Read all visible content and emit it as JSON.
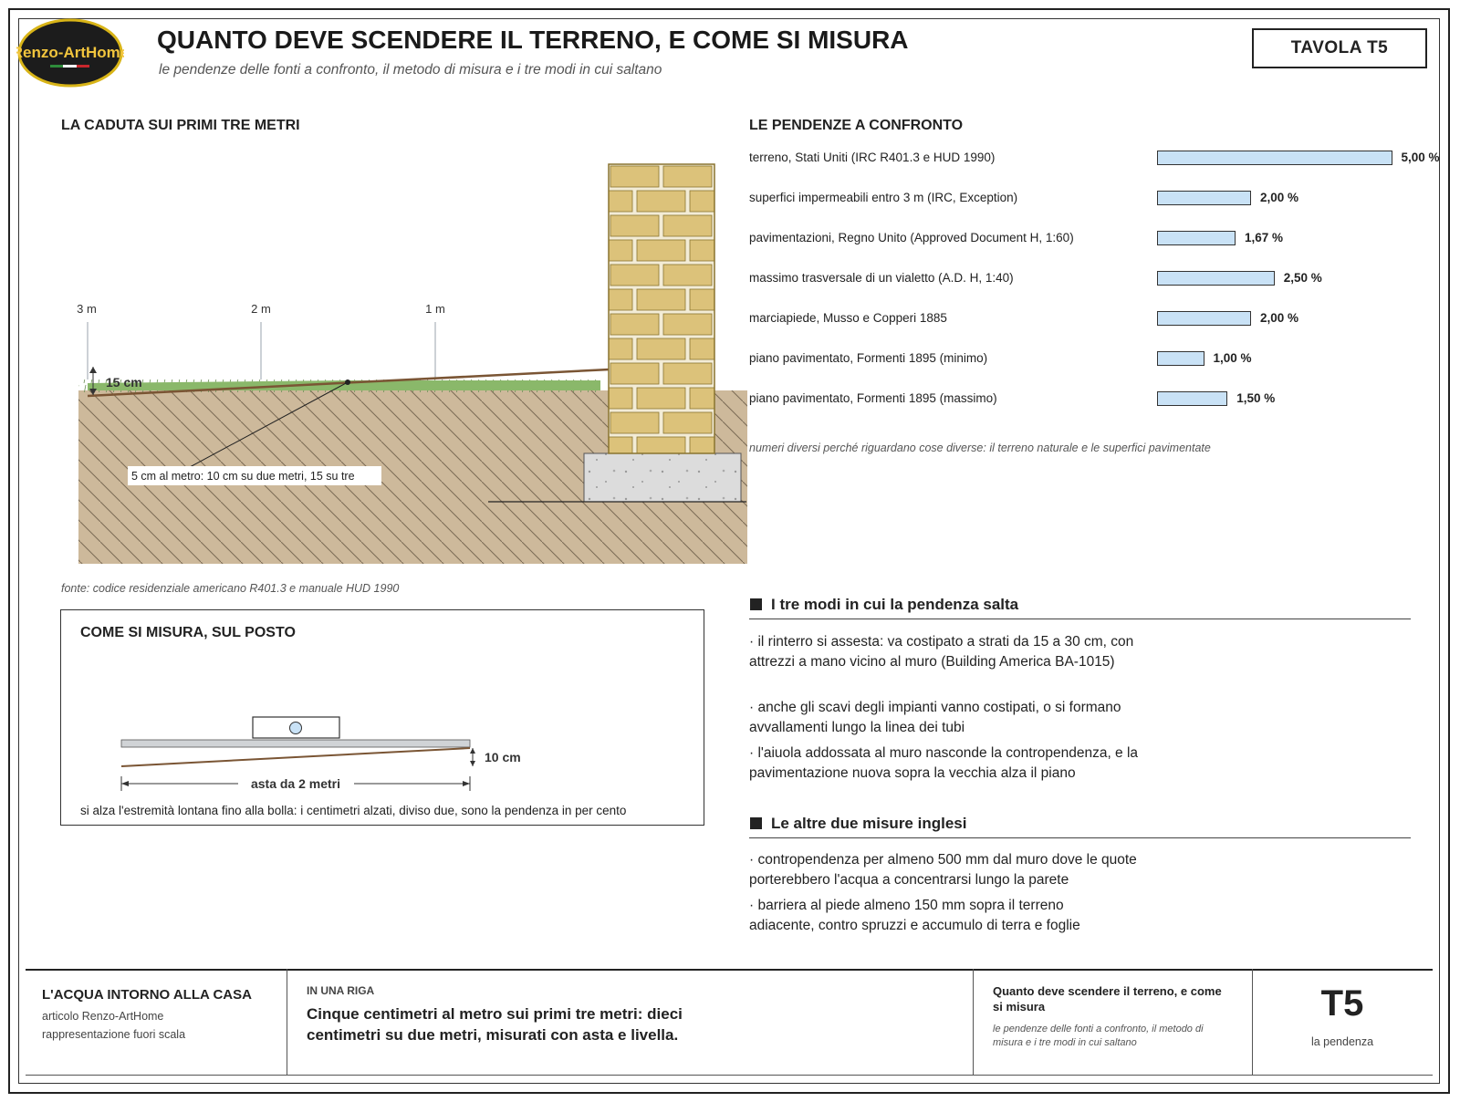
{
  "header": {
    "logo_text": "Renzo-ArtHome",
    "title": "QUANTO DEVE SCENDERE IL TERRENO, E COME SI MISURA",
    "subtitle": "le pendenze delle fonti a confronto, il metodo di misura e i tre modi in cui saltano",
    "tavola": "TAVOLA T5"
  },
  "fall_section": {
    "title": "LA CADUTA SUI PRIMI TRE METRI",
    "marks": [
      "3 m",
      "2 m",
      "1 m"
    ],
    "drop_label": "15 cm",
    "callout": "5 cm al metro: 10 cm su due metri, 15 su tre",
    "source": "fonte: codice residenziale americano R401.3 e manuale HUD 1990"
  },
  "measure_section": {
    "title": "COME SI MISURA, SUL POSTO",
    "rise_label": "10 cm",
    "rod_label": "asta da 2 metri",
    "caption": "si alza l'estremità lontana fino alla bolla: i centimetri alzati, diviso due, sono la pendenza in per cento"
  },
  "comparison": {
    "title": "LE PENDENZE A CONFRONTO",
    "note": "numeri diversi perché riguardano cose diverse: il terreno naturale e le superfici pavimentate",
    "chart_data": {
      "type": "bar",
      "orientation": "horizontal",
      "unit": "%",
      "categories": [
        "terreno, Stati Uniti (IRC R401.3 e HUD 1990)",
        "superfici impermeabili entro 3 m (IRC, Exception)",
        "pavimentazioni, Regno Unito (Approved Document H, 1:60)",
        "massimo trasversale di un vialetto (A.D. H, 1:40)",
        "marciapiede, Musso e Copperi 1885",
        "piano pavimentato, Formenti 1895 (minimo)",
        "piano pavimentato, Formenti 1895 (massimo)"
      ],
      "values": [
        5.0,
        2.0,
        1.67,
        2.5,
        2.0,
        1.0,
        1.5
      ],
      "value_labels": [
        "5,00 %",
        "2,00 %",
        "1,67 %",
        "2,50 %",
        "2,00 %",
        "1,00 %",
        "1,50 %"
      ],
      "bar_color": "#c9e2f6"
    }
  },
  "jumps": {
    "title": "I tre modi in cui la pendenza salta",
    "items": [
      "· il rinterro si assesta: va costipato a strati da 15 a 30 cm, con attrezzi a mano vicino al muro (Building America BA-1015)",
      "· anche gli scavi degli impianti vanno costipati, o si formano avvallamenti lungo la linea dei tubi",
      "· l'aiuola addossata al muro nasconde la contropendenza, e la pavimentazione nuova sopra la vecchia alza il piano"
    ]
  },
  "english": {
    "title": "Le altre due misure inglesi",
    "items": [
      "· contropendenza per almeno 500 mm dal muro dove le quote porterebbero l'acqua a concentrarsi lungo la parete",
      "· barriera al piede almeno 150 mm sopra il terreno adiacente, contro spruzzi e accumulo di terra e foglie"
    ]
  },
  "footer": {
    "series_title": "L'ACQUA INTORNO ALLA CASA",
    "article": "articolo Renzo-ArtHome",
    "scale": "rappresentazione fuori scala",
    "one_line_label": "IN UNA RIGA",
    "one_line": "Cinque centimetri al metro sui primi tre metri: dieci centimetri su due metri, misurati con asta e livella.",
    "sheet_title": "Quanto deve scendere il terreno, e come si misura",
    "sheet_subtitle": "le pendenze delle fonti a confronto, il metodo di misura e i tre modi in cui saltano",
    "code": "T5",
    "code_caption": "la pendenza"
  }
}
